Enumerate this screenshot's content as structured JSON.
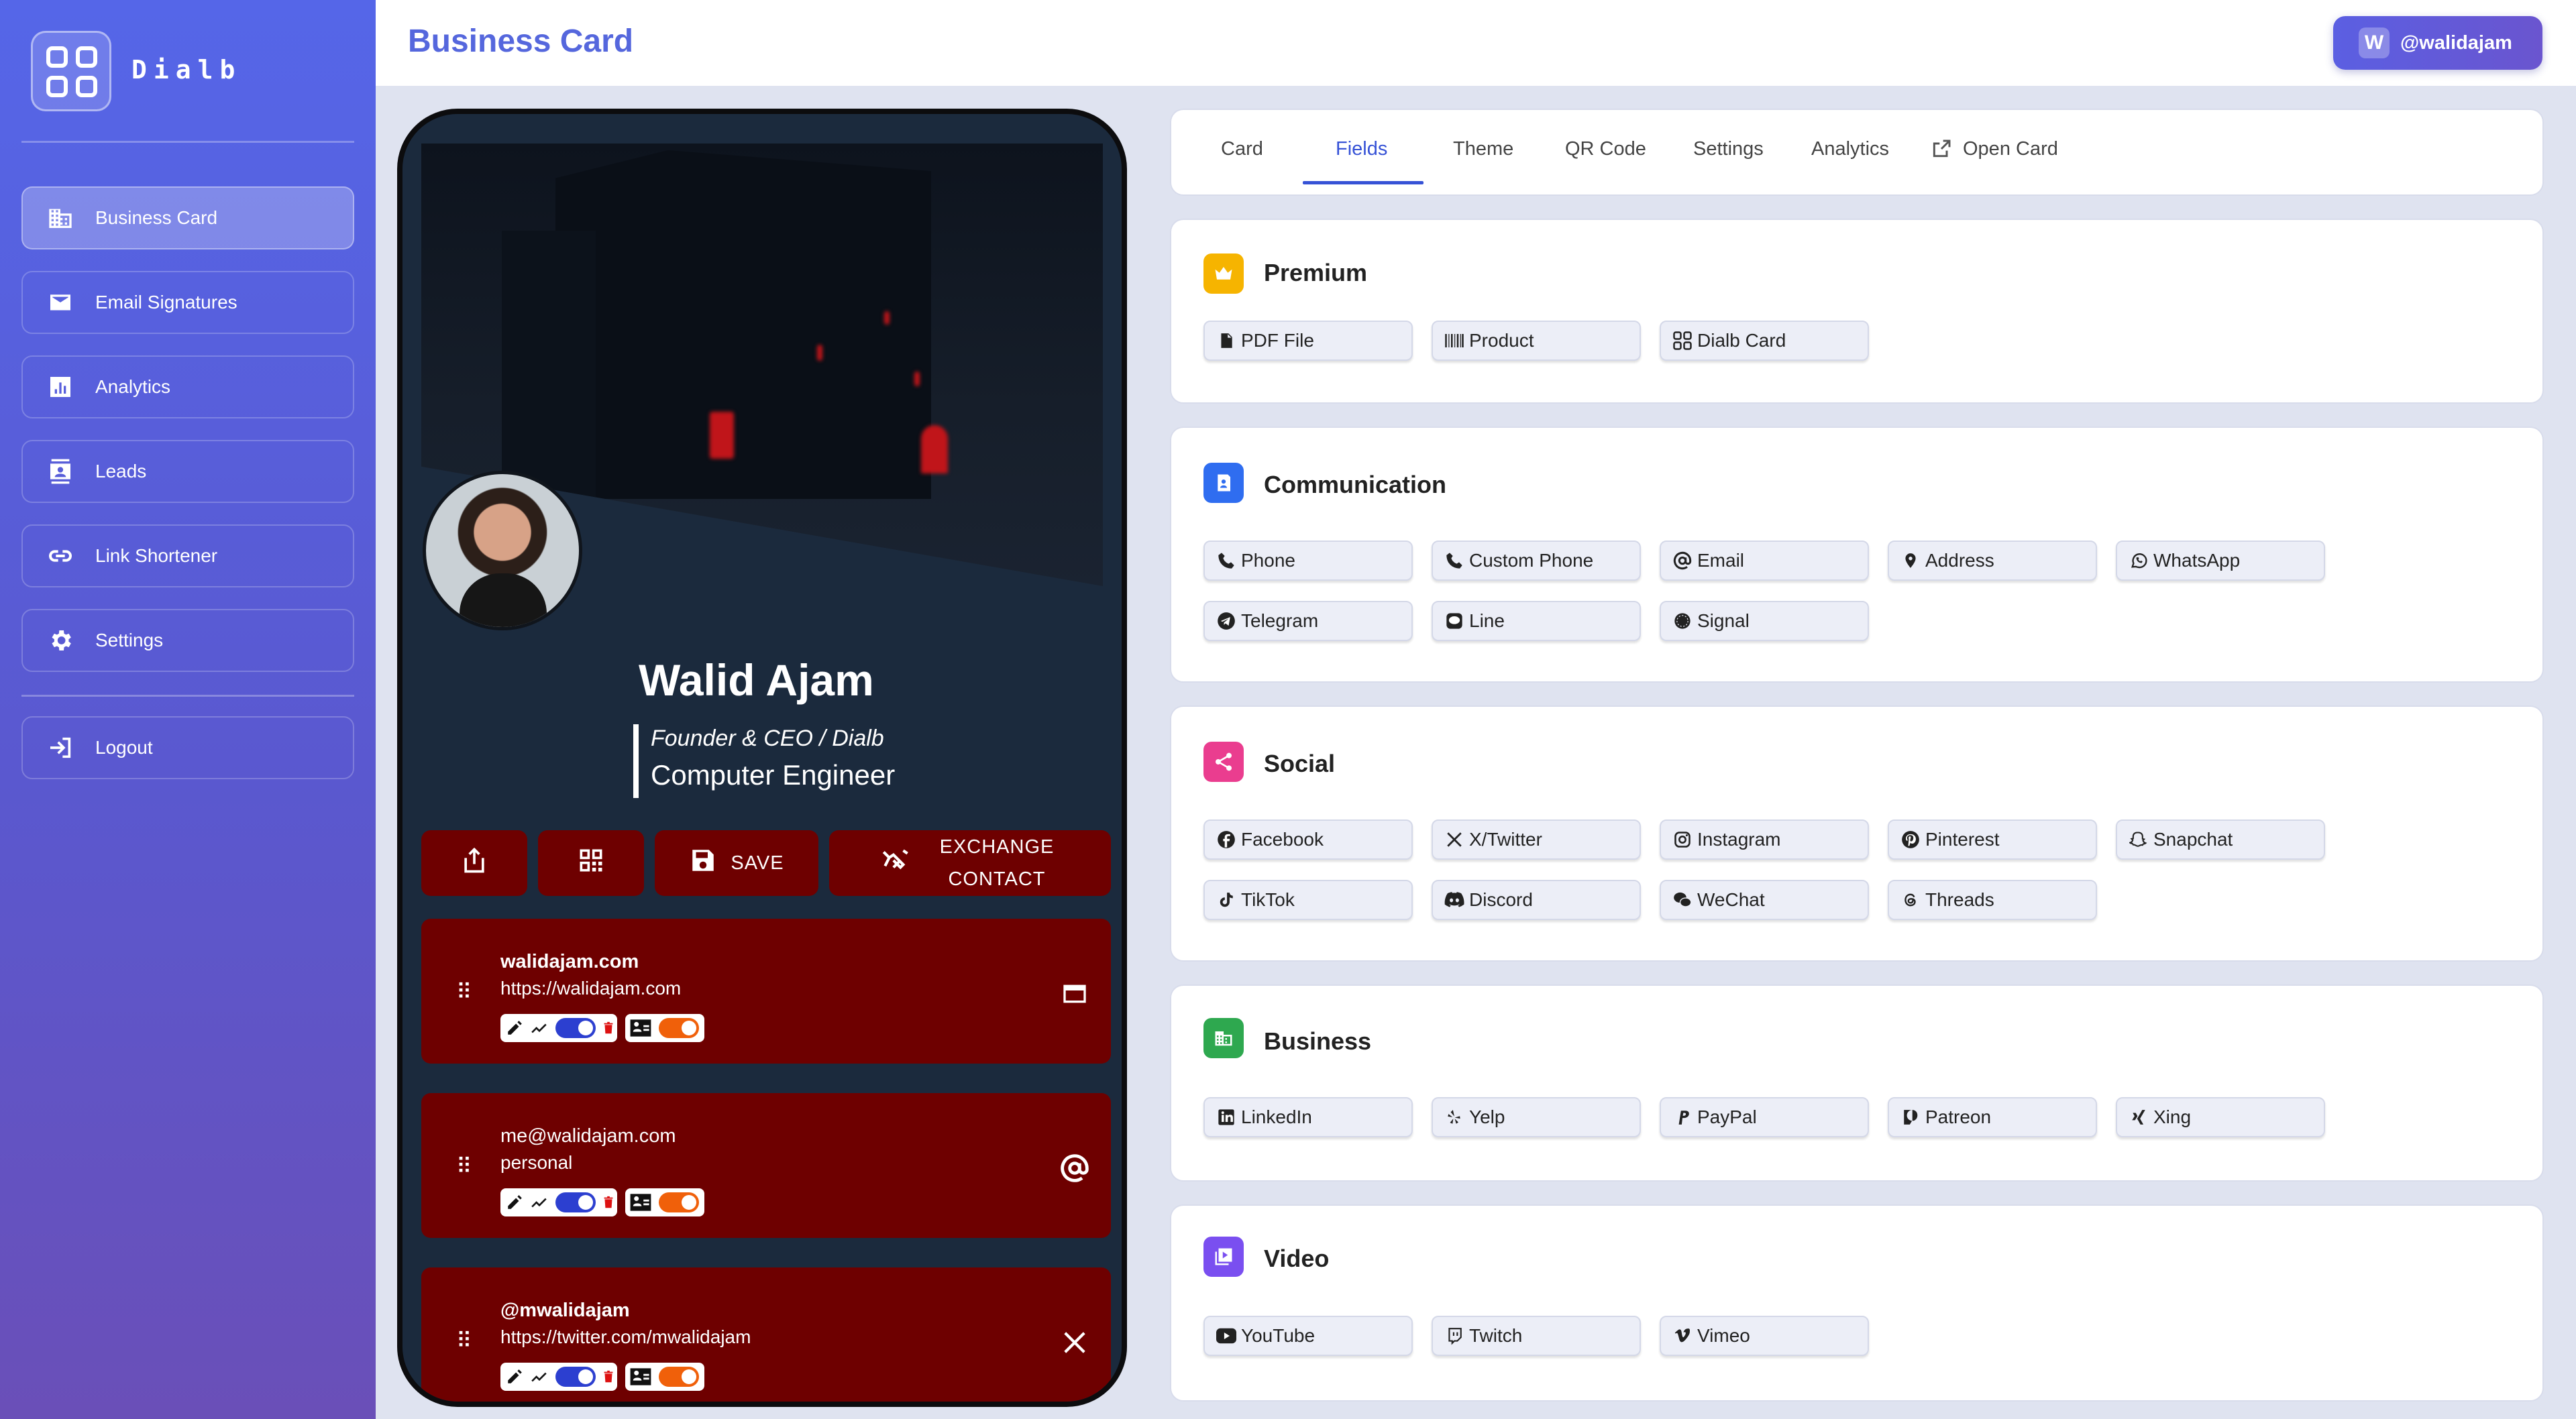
{
  "app": {
    "name": "Dialb"
  },
  "sidebar": {
    "items": [
      {
        "label": "Business Card",
        "icon": "building-icon"
      },
      {
        "label": "Email Signatures",
        "icon": "mail-icon"
      },
      {
        "label": "Analytics",
        "icon": "chart-icon"
      },
      {
        "label": "Leads",
        "icon": "contacts-icon"
      },
      {
        "label": "Link Shortener",
        "icon": "link-icon"
      },
      {
        "label": "Settings",
        "icon": "gear-icon"
      }
    ],
    "logout": "Logout"
  },
  "header": {
    "title": "Business Card",
    "user_initial": "W",
    "username": "@walidajam"
  },
  "card": {
    "name": "Walid Ajam",
    "title": "Founder & CEO / Dialb",
    "subtitle": "Computer Engineer",
    "actions": {
      "save": "SAVE",
      "exchange_line1": "EXCHANGE",
      "exchange_line2": "CONTACT"
    },
    "fields": [
      {
        "line1": "walidajam.com",
        "line2": "https://walidajam.com",
        "icon": "browser-icon"
      },
      {
        "line1": "me@walidajam.com",
        "line2": "personal",
        "icon": "at-icon"
      },
      {
        "line1": "@mwalidajam",
        "line2": "https://twitter.com/mwalidajam",
        "icon": "x-icon"
      }
    ],
    "colors": {
      "field_bg": "#6e0000",
      "toggle_blue": "#2c3fd0",
      "toggle_orange": "#f0600a"
    }
  },
  "tabs": [
    "Card",
    "Fields",
    "Theme",
    "QR Code",
    "Settings",
    "Analytics",
    "Open Card"
  ],
  "active_tab": "Fields",
  "sections": [
    {
      "title": "Premium",
      "color": "#f6b400",
      "items": [
        "PDF File",
        "Product",
        "Dialb Card"
      ]
    },
    {
      "title": "Communication",
      "color": "#2f6df0",
      "items": [
        "Phone",
        "Custom Phone",
        "Email",
        "Address",
        "WhatsApp",
        "Telegram",
        "Line",
        "Signal"
      ]
    },
    {
      "title": "Social",
      "color": "#ea3d8f",
      "items": [
        "Facebook",
        "X/Twitter",
        "Instagram",
        "Pinterest",
        "Snapchat",
        "TikTok",
        "Discord",
        "WeChat",
        "Threads"
      ]
    },
    {
      "title": "Business",
      "color": "#2ea84f",
      "items": [
        "LinkedIn",
        "Yelp",
        "PayPal",
        "Patreon",
        "Xing"
      ]
    },
    {
      "title": "Video",
      "color": "#7a4ff0",
      "items": [
        "YouTube",
        "Twitch",
        "Vimeo"
      ]
    }
  ]
}
